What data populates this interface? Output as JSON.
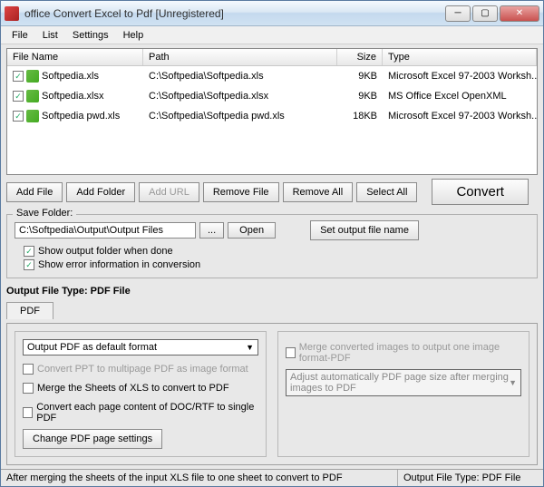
{
  "window": {
    "title": "office Convert Excel to Pdf [Unregistered]"
  },
  "menu": {
    "file": "File",
    "list": "List",
    "settings": "Settings",
    "help": "Help"
  },
  "columns": {
    "filename": "File Name",
    "path": "Path",
    "size": "Size",
    "type": "Type"
  },
  "files": [
    {
      "name": "Softpedia.xls",
      "path": "C:\\Softpedia\\Softpedia.xls",
      "size": "9KB",
      "type": "Microsoft Excel 97-2003 Worksh..."
    },
    {
      "name": "Softpedia.xlsx",
      "path": "C:\\Softpedia\\Softpedia.xlsx",
      "size": "9KB",
      "type": "MS Office Excel OpenXML"
    },
    {
      "name": "Softpedia pwd.xls",
      "path": "C:\\Softpedia\\Softpedia pwd.xls",
      "size": "18KB",
      "type": "Microsoft Excel 97-2003 Worksh..."
    }
  ],
  "buttons": {
    "add_file": "Add File",
    "add_folder": "Add Folder",
    "add_url": "Add URL",
    "remove_file": "Remove File",
    "remove_all": "Remove All",
    "select_all": "Select All",
    "convert": "Convert",
    "browse": "...",
    "open": "Open",
    "set_output_name": "Set output file name",
    "change_pdf_settings": "Change PDF page settings"
  },
  "save_folder": {
    "label": "Save Folder:",
    "path": "C:\\Softpedia\\Output\\Output Files",
    "show_output": "Show output folder when done",
    "show_error": "Show error information in conversion"
  },
  "output": {
    "label": "Output File Type:  PDF File",
    "tab": "PDF"
  },
  "pdf_options": {
    "combo_default": "Output PDF as default format",
    "convert_ppt": "Convert PPT to multipage PDF as image format",
    "merge_sheets": "Merge the Sheets of XLS to convert to PDF",
    "convert_each_page": "Convert each page content of DOC/RTF to single PDF",
    "merge_images": "Merge converted images to output one image format-PDF",
    "adjust_auto": "Adjust automatically PDF page size after merging images to PDF"
  },
  "statusbar": {
    "left": "After merging the sheets of the input XLS file to one sheet to convert to PDF",
    "right": "Output File Type:  PDF File"
  }
}
